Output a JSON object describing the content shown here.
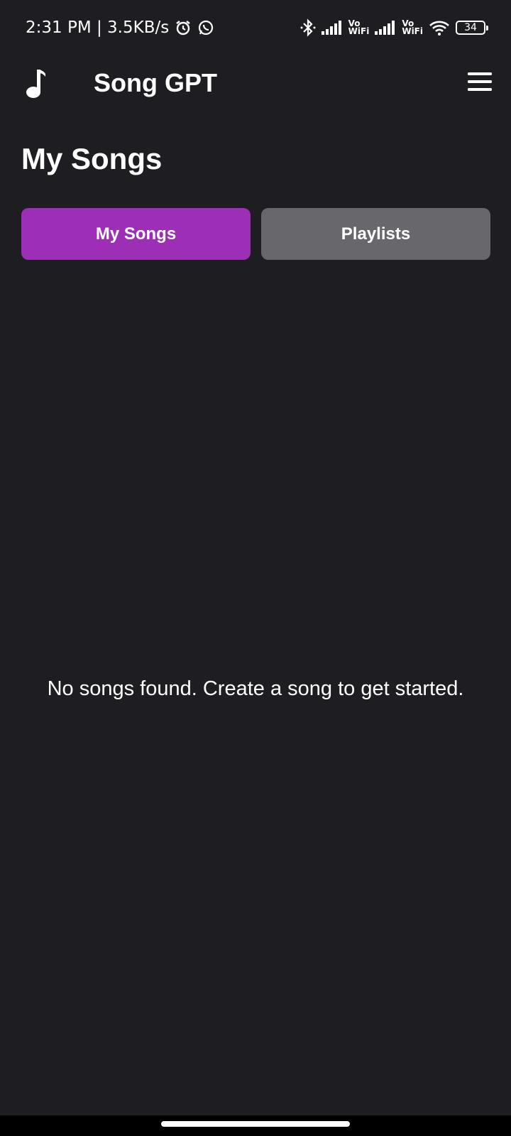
{
  "status_bar": {
    "time": "2:31 PM | 3.5KB/s",
    "vowifi_top": "Vo",
    "vowifi_bottom": "WiFi",
    "battery": "34",
    "icons": [
      "alarm-icon",
      "whatsapp-icon",
      "bluetooth-icon",
      "signal-icon",
      "vowifi-icon",
      "signal-icon",
      "vowifi-icon",
      "wifi-icon",
      "battery-icon"
    ]
  },
  "app_bar": {
    "title": "Song GPT",
    "logo_icon": "music-note-icon",
    "menu_icon": "hamburger-menu-icon"
  },
  "page": {
    "title": "My Songs"
  },
  "tabs": [
    {
      "label": "My Songs",
      "active": true
    },
    {
      "label": "Playlists",
      "active": false
    }
  ],
  "empty_state": {
    "message": "No songs found. Create a song to get started."
  },
  "colors": {
    "background": "#1e1d22",
    "tab_active": "#9c2fb5",
    "tab_inactive": "#68686c",
    "text": "#ffffff"
  }
}
